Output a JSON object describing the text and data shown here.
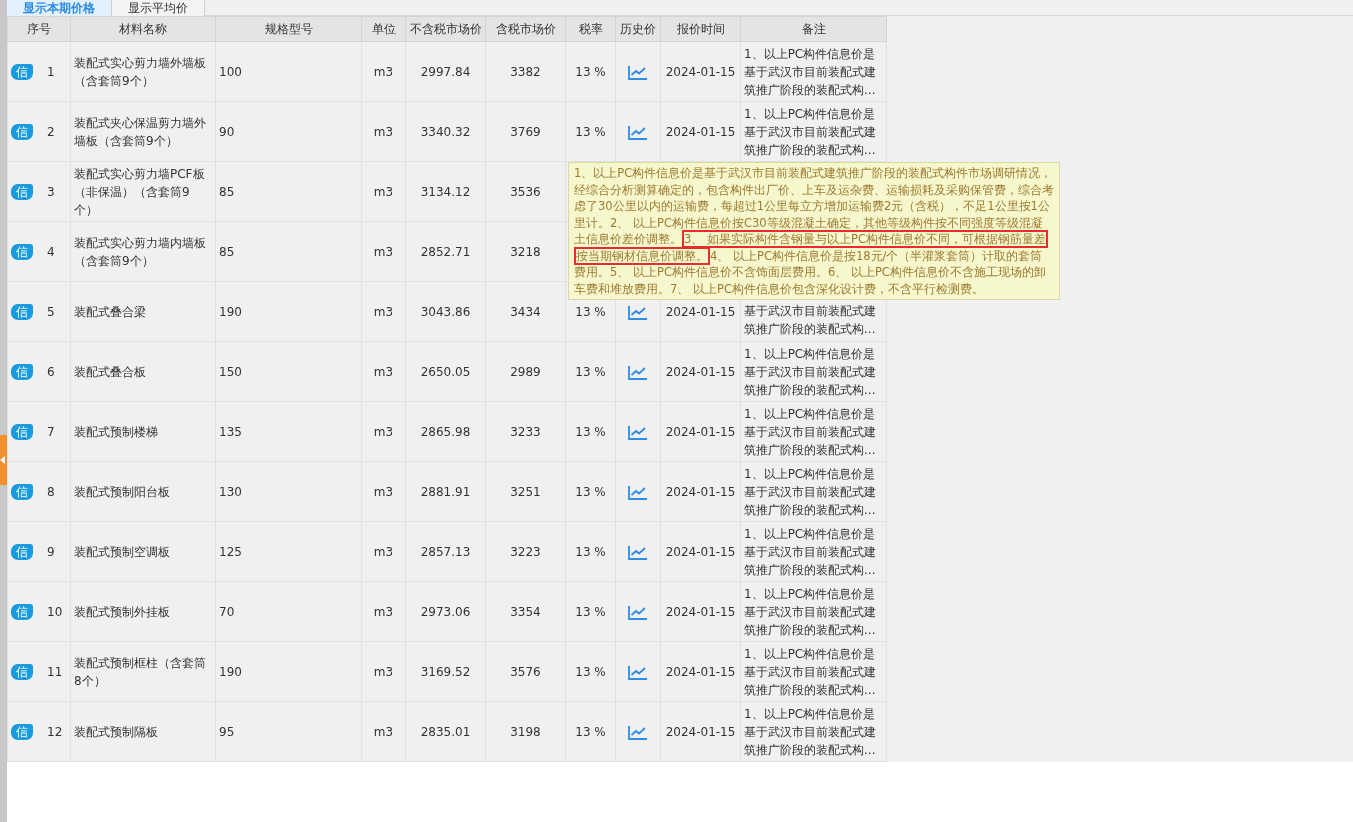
{
  "tabs": [
    {
      "label": "显示本期价格",
      "selected": true
    },
    {
      "label": "显示平均价",
      "selected": false
    }
  ],
  "columns": [
    "序号",
    "材料名称",
    "规格型号",
    "单位",
    "不含税市场价",
    "含税市场价",
    "税率",
    "历史价",
    "报价时间",
    "备注"
  ],
  "rows": [
    {
      "badge": "信",
      "no": "1",
      "name": "装配式实心剪力墙外墙板（含套筒9个）",
      "spec": "100",
      "unit": "m3",
      "price_ex": "2997.84",
      "price_in": "3382",
      "rate": "13 %",
      "date": "2024-01-15",
      "note": "1、以上PC构件信息价是基于武汉市目前装配式建筑推广阶段的装配式构..."
    },
    {
      "badge": "信",
      "no": "2",
      "name": "装配式夹心保温剪力墙外墙板（含套筒9个）",
      "spec": "90",
      "unit": "m3",
      "price_ex": "3340.32",
      "price_in": "3769",
      "rate": "13 %",
      "date": "2024-01-15",
      "note": "1、以上PC构件信息价是基于武汉市目前装配式建筑推广阶段的装配式构..."
    },
    {
      "badge": "信",
      "no": "3",
      "name": "装配式实心剪力墙PCF板（非保温）（含套筒9个）",
      "spec": "85",
      "unit": "m3",
      "price_ex": "3134.12",
      "price_in": "3536"
    },
    {
      "badge": "信",
      "no": "4",
      "name": "装配式实心剪力墙内墙板（含套筒9个）",
      "spec": "85",
      "unit": "m3",
      "price_ex": "2852.71",
      "price_in": "3218"
    },
    {
      "badge": "信",
      "no": "5",
      "name": "装配式叠合梁",
      "spec": "190",
      "unit": "m3",
      "price_ex": "3043.86",
      "price_in": "3434",
      "rate": "13 %",
      "date": "2024-01-15",
      "note": "基于武汉市目前装配式建筑推广阶段的装配式构..."
    },
    {
      "badge": "信",
      "no": "6",
      "name": "装配式叠合板",
      "spec": "150",
      "unit": "m3",
      "price_ex": "2650.05",
      "price_in": "2989",
      "rate": "13 %",
      "date": "2024-01-15",
      "note": "1、以上PC构件信息价是基于武汉市目前装配式建筑推广阶段的装配式构..."
    },
    {
      "badge": "信",
      "no": "7",
      "name": "装配式预制楼梯",
      "spec": "135",
      "unit": "m3",
      "price_ex": "2865.98",
      "price_in": "3233",
      "rate": "13 %",
      "date": "2024-01-15",
      "note": "1、以上PC构件信息价是基于武汉市目前装配式建筑推广阶段的装配式构..."
    },
    {
      "badge": "信",
      "no": "8",
      "name": "装配式预制阳台板",
      "spec": "130",
      "unit": "m3",
      "price_ex": "2881.91",
      "price_in": "3251",
      "rate": "13 %",
      "date": "2024-01-15",
      "note": "1、以上PC构件信息价是基于武汉市目前装配式建筑推广阶段的装配式构..."
    },
    {
      "badge": "信",
      "no": "9",
      "name": "装配式预制空调板",
      "spec": "125",
      "unit": "m3",
      "price_ex": "2857.13",
      "price_in": "3223",
      "rate": "13 %",
      "date": "2024-01-15",
      "note": "1、以上PC构件信息价是基于武汉市目前装配式建筑推广阶段的装配式构..."
    },
    {
      "badge": "信",
      "no": "10",
      "name": "装配式预制外挂板",
      "spec": "70",
      "unit": "m3",
      "price_ex": "2973.06",
      "price_in": "3354",
      "rate": "13 %",
      "date": "2024-01-15",
      "note": "1、以上PC构件信息价是基于武汉市目前装配式建筑推广阶段的装配式构..."
    },
    {
      "badge": "信",
      "no": "11",
      "name": "装配式预制框柱（含套筒8个）",
      "spec": "190",
      "unit": "m3",
      "price_ex": "3169.52",
      "price_in": "3576",
      "rate": "13 %",
      "date": "2024-01-15",
      "note": "1、以上PC构件信息价是基于武汉市目前装配式建筑推广阶段的装配式构..."
    },
    {
      "badge": "信",
      "no": "12",
      "name": "装配式预制隔板",
      "spec": "95",
      "unit": "m3",
      "price_ex": "2835.01",
      "price_in": "3198",
      "rate": "13 %",
      "date": "2024-01-15",
      "note": "1、以上PC构件信息价是基于武汉市目前装配式建筑推广阶段的装配式构..."
    }
  ],
  "tooltip": {
    "segments": [
      {
        "text": "1、以上PC构件信息价是基于武汉市目前装配式建筑推广阶段的装配式构件市场调研情况，经综合分析测算确定的，包含构件出厂价、上车及运杂费、运输损耗及采购保管费，综合考虑了30公里以内的运输费，每超过1公里每立方增加运输费2元（含税），不足1公里按1公里计。2、 以上PC构件信息价按C30等级混凝土确定，其他等级构件按不同强度等级混凝土信息价差价调整。",
        "highlighted": false
      },
      {
        "text": "3、 如果实际构件含钢量与以上PC构件信息价不同，可根据钢筋量差按当期钢材信息价调整。",
        "highlighted": true
      },
      {
        "text": "4、 以上PC构件信息价是按18元/个（半灌浆套筒）计取的套筒费用。5、 以上PC构件信息价不含饰面层费用。6、 以上PC构件信息价不含施工现场的卸车费和堆放费用。7、 以上PC构件信息价包含深化设计费，不含平行检测费。",
        "highlighted": false
      }
    ]
  }
}
